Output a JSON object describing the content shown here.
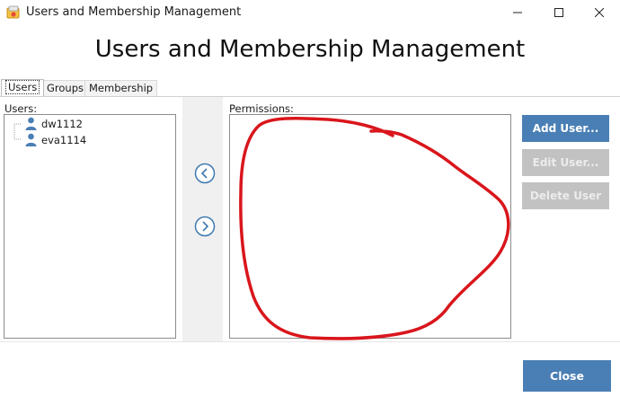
{
  "window": {
    "title": "Users and Membership Management",
    "icons": [
      "app-icon",
      "minimize-icon",
      "maximize-icon",
      "close-icon"
    ]
  },
  "heading": "Users and Membership Management",
  "tabs": [
    {
      "label": "Users",
      "selected": true
    },
    {
      "label": "Groups",
      "selected": false
    },
    {
      "label": "Membership",
      "selected": false
    }
  ],
  "users_panel": {
    "label": "Users:",
    "items": [
      {
        "name": "dw1112",
        "icon": "user-icon"
      },
      {
        "name": "eva1114",
        "icon": "user-icon"
      }
    ]
  },
  "transfer": {
    "icons": [
      "arrow-left-circle-icon",
      "arrow-right-circle-icon"
    ]
  },
  "permissions_panel": {
    "label": "Permissions:",
    "items": []
  },
  "actions": {
    "add_user": "Add User...",
    "edit_user": "Edit User...",
    "delete_user": "Delete User"
  },
  "close_label": "Close",
  "colors": {
    "primary_button": "#4a7fb5",
    "disabled_button": "#c2c2c2",
    "annotation": "#d9161c"
  }
}
